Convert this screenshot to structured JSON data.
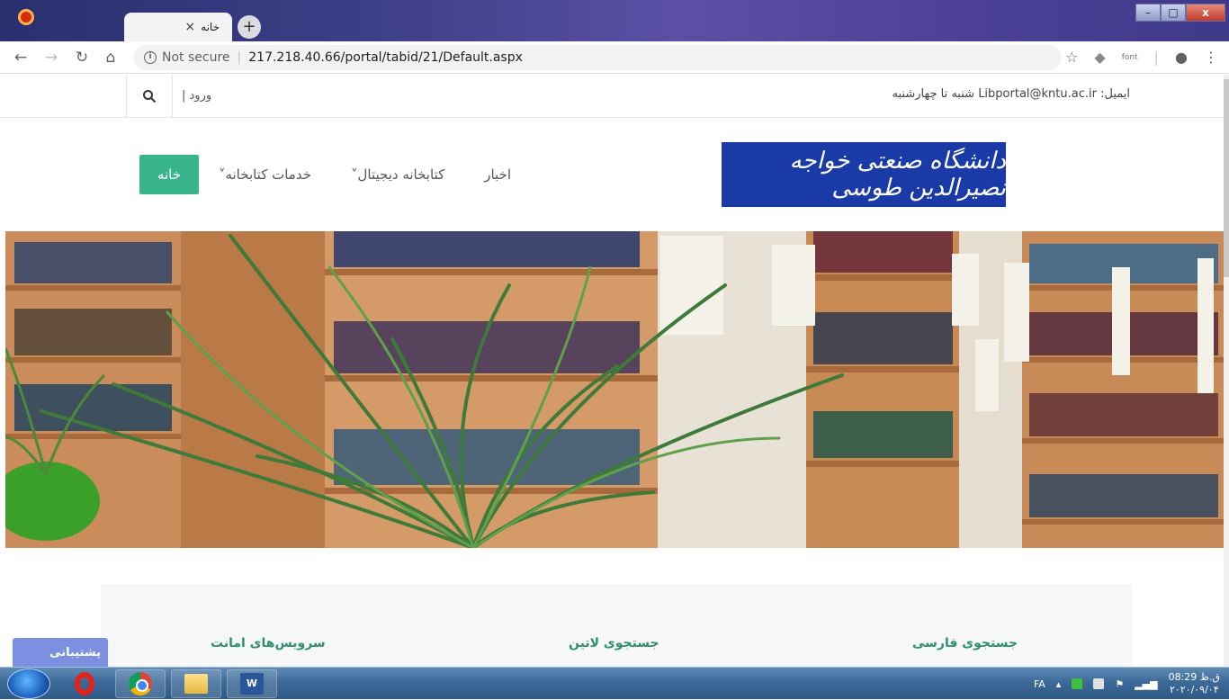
{
  "browser": {
    "tab_title": "خانه",
    "tab_close": "×",
    "new_tab": "+",
    "url": "217.218.40.66/portal/tabid/21/Default.aspx",
    "not_secure": "Not secure",
    "font_extension": "font"
  },
  "window_controls": {
    "minimize": "–",
    "maximize": "□",
    "close": "x"
  },
  "topbar": {
    "login_label": "| ورود",
    "contact": "ایمیل: Libportal@kntu.ac.ir شنبه تا چهارشنبه"
  },
  "header": {
    "logo_text": "دانشگاه صنعتی خواجه نصیرالدین طوسی"
  },
  "menu": {
    "home": "خانه",
    "services": "خدمات کتابخانه˅",
    "digital": "کتابخانه دیجیتال˅",
    "news": "اخبار"
  },
  "services": {
    "persian_search": "جستجوی فارسی",
    "latin_search": "جستجوی لاتین",
    "loan_services": "سرویس‌های امانت"
  },
  "support": {
    "label": "پشتیبانی"
  },
  "taskbar": {
    "language": "FA",
    "time": "08:29 ق.ظ",
    "date": "۲۰۲۰/۰۹/۰۴"
  },
  "colors": {
    "accent": "#39b58e",
    "logo_bg": "#1a3aa8",
    "support_bg": "#7b90e0"
  }
}
